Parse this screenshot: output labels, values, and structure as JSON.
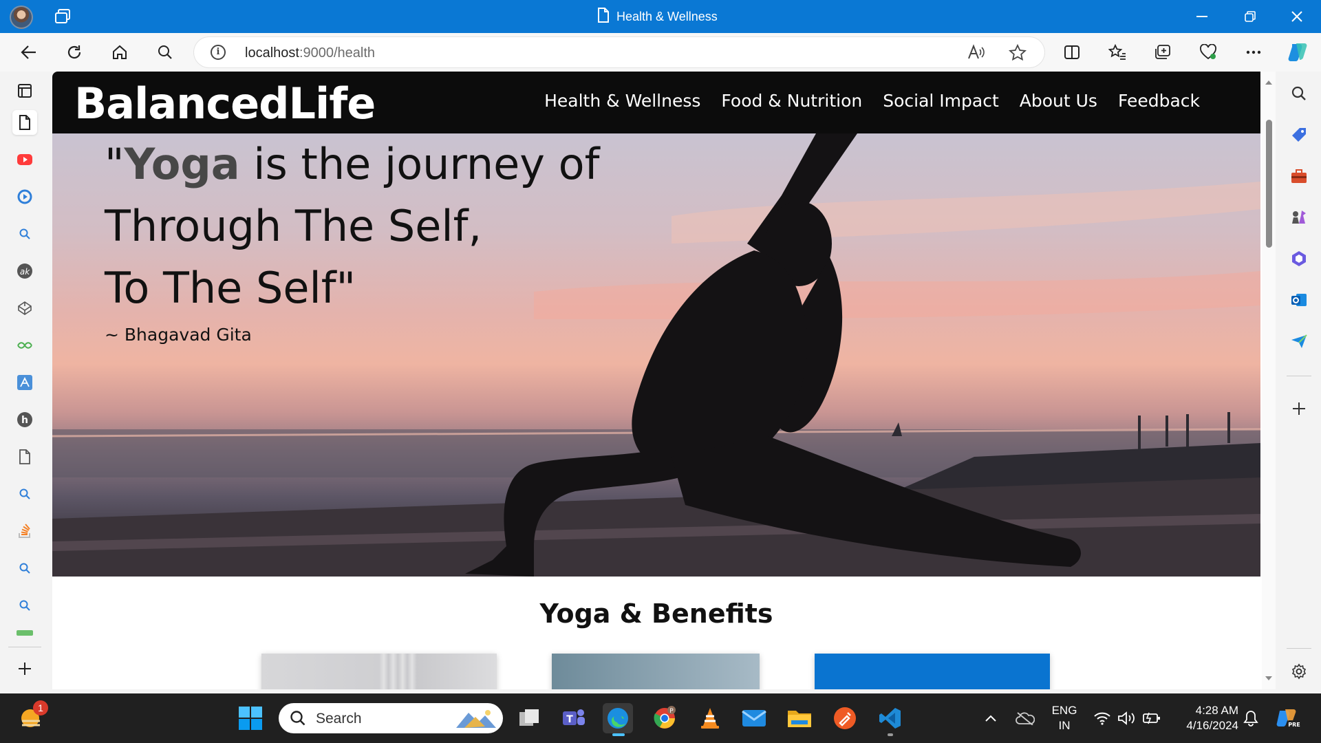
{
  "window": {
    "tab_title": "Health & Wellness"
  },
  "addressbar": {
    "url_host": "localhost",
    "url_path": ":9000/health"
  },
  "site": {
    "brand": "BalancedLife",
    "nav": [
      "Health & Wellness",
      "Food & Nutrition",
      "Social Impact",
      "About Us",
      "Feedback"
    ],
    "quote": {
      "open": "\"",
      "accent": "Yoga",
      "line1_rest": " is the journey of",
      "line2": "Through The Self,",
      "line3": "To The Self\"",
      "attribution": "~ Bhagavad Gita"
    },
    "section_title": "Yoga & Benefits"
  },
  "taskbar": {
    "search_label": "Search",
    "notification_count": "1",
    "lang_top": "ENG",
    "lang_bottom": "IN",
    "time": "4:28 AM",
    "date": "4/16/2024"
  },
  "colors": {
    "titlebar": "#0a78d4",
    "site_header": "#0c0c0c",
    "taskbar": "#202020"
  }
}
